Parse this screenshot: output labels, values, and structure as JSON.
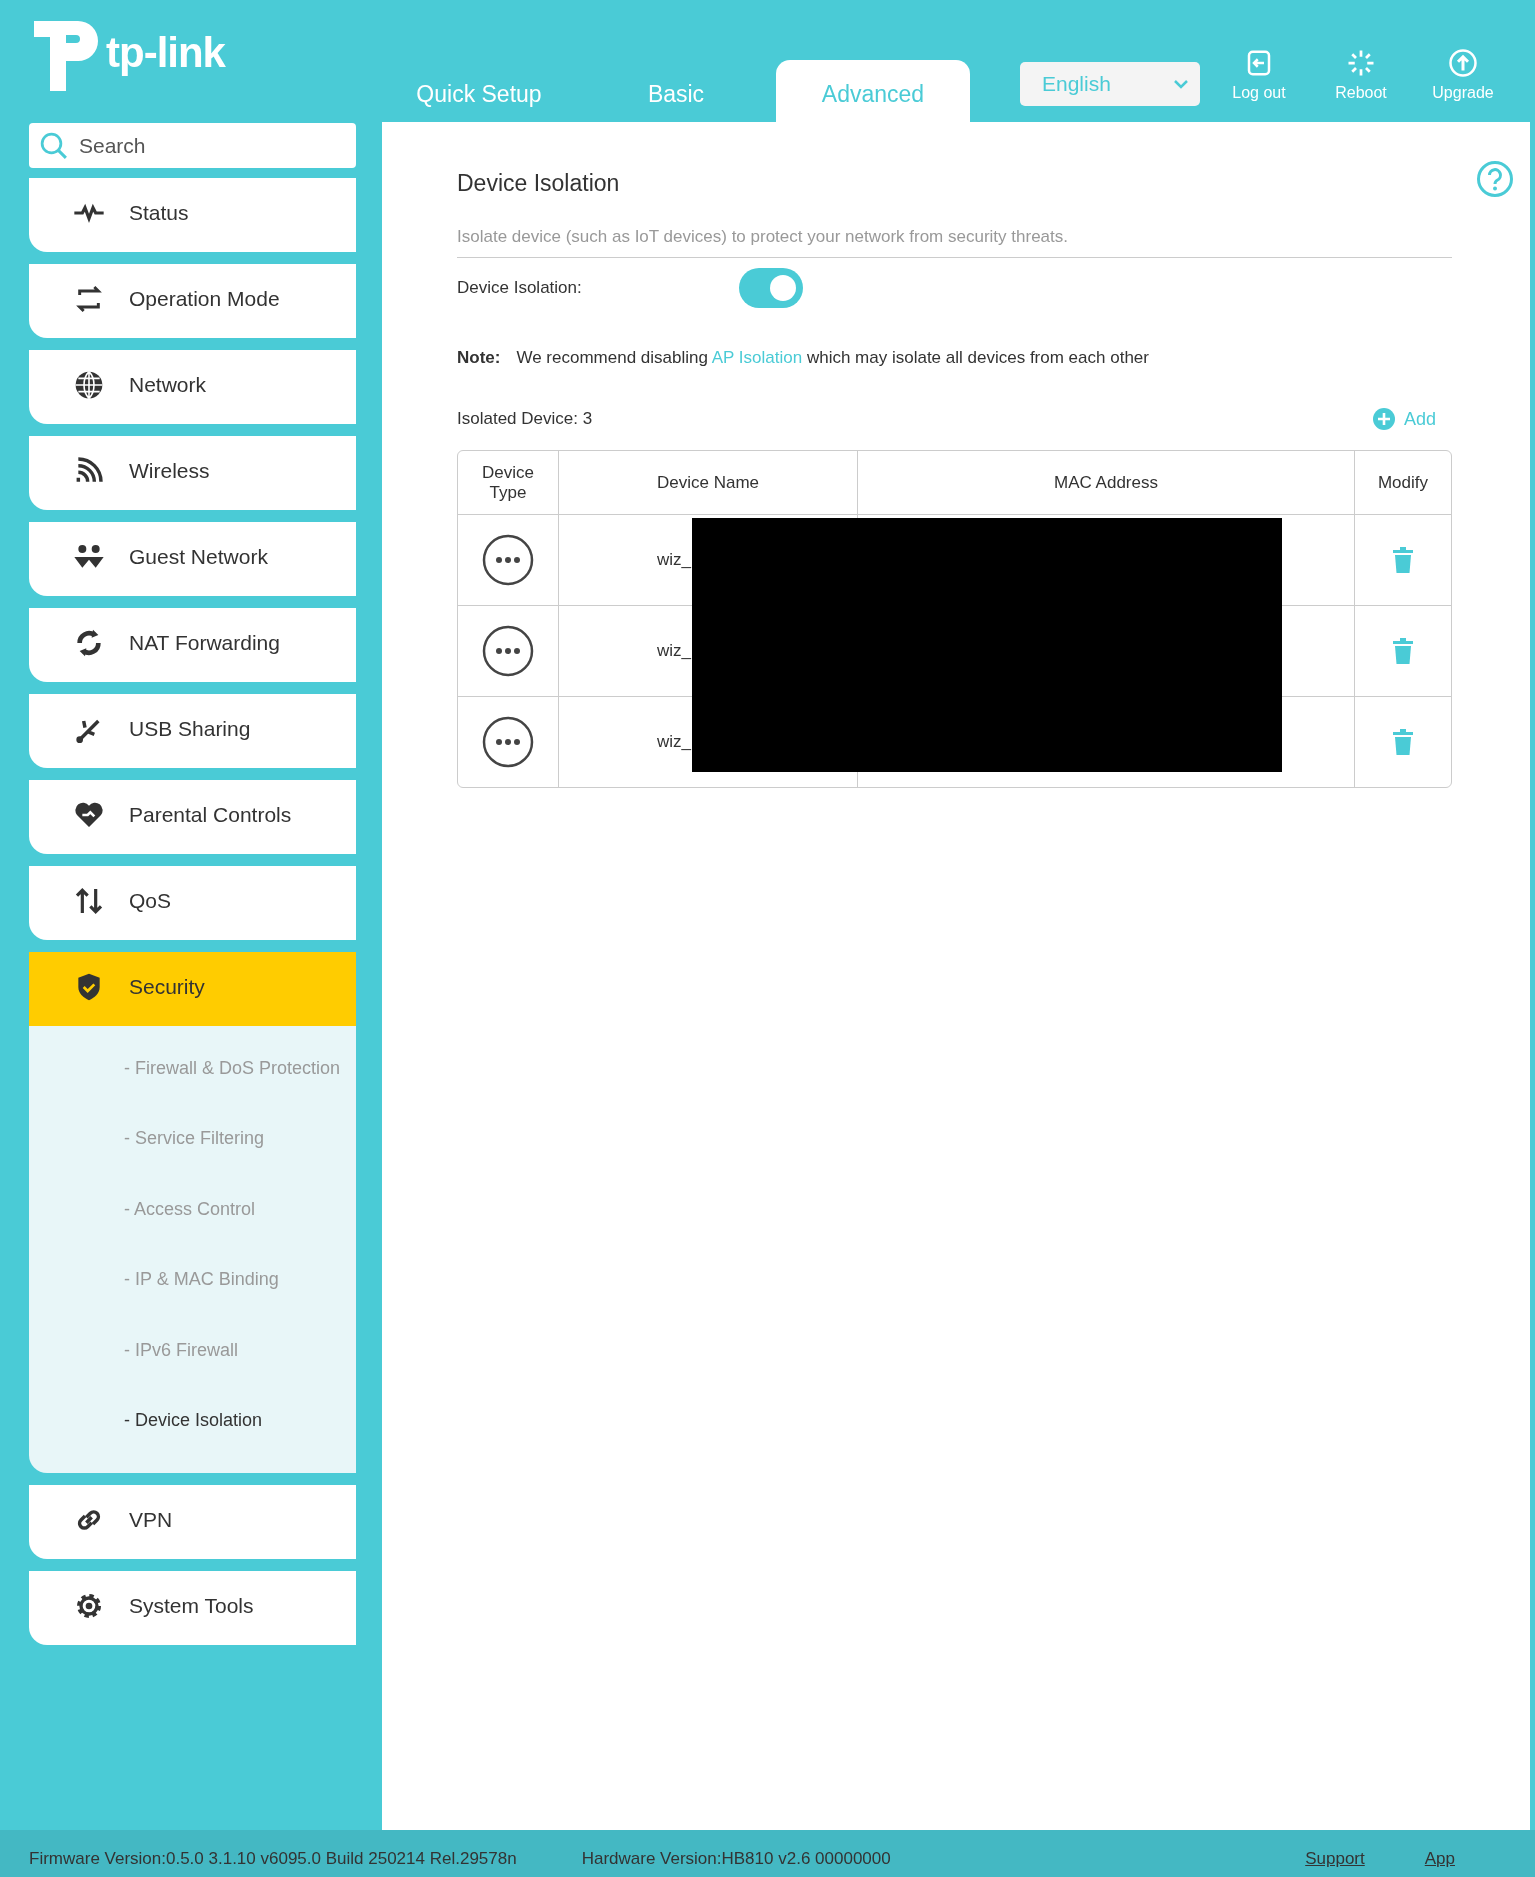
{
  "header": {
    "logo": "tp-link",
    "tabs": [
      {
        "label": "Quick Setup",
        "selected": false
      },
      {
        "label": "Basic",
        "selected": false
      },
      {
        "label": "Advanced",
        "selected": true
      }
    ],
    "language": "English",
    "actions": [
      {
        "kind": "logout",
        "label": "Log out"
      },
      {
        "kind": "reboot",
        "label": "Reboot"
      },
      {
        "kind": "upgrade",
        "label": "Upgrade"
      }
    ]
  },
  "sidebar": {
    "search": {
      "placeholder": "Search"
    },
    "items": [
      {
        "kind": "status",
        "label": "Status",
        "selected": false
      },
      {
        "kind": "mode",
        "label": "Operation Mode",
        "selected": false
      },
      {
        "kind": "globe",
        "label": "Network",
        "selected": false
      },
      {
        "kind": "wireless",
        "label": "Wireless",
        "selected": false
      },
      {
        "kind": "guest",
        "label": "Guest Network",
        "selected": false
      },
      {
        "kind": "nat",
        "label": "NAT Forwarding",
        "selected": false
      },
      {
        "kind": "usb",
        "label": "USB Sharing",
        "selected": false
      },
      {
        "kind": "heart",
        "label": "Parental Controls",
        "selected": false
      },
      {
        "kind": "qos",
        "label": "QoS",
        "selected": false
      },
      {
        "kind": "shield",
        "label": "Security",
        "selected": true,
        "children": [
          {
            "label": "- Firewall & DoS Protection",
            "selected": false
          },
          {
            "label": "- Service Filtering",
            "selected": false
          },
          {
            "label": "- Access Control",
            "selected": false
          },
          {
            "label": "- IP & MAC Binding",
            "selected": false
          },
          {
            "label": "- IPv6 Firewall",
            "selected": false
          },
          {
            "label": "- Device Isolation",
            "selected": true
          }
        ]
      },
      {
        "kind": "vpn",
        "label": "VPN",
        "selected": false
      },
      {
        "kind": "gear",
        "label": "System Tools",
        "selected": false
      }
    ]
  },
  "content": {
    "title": "Device Isolation",
    "description": "Isolate device (such as IoT devices) to protect your network from security threats.",
    "isolation": {
      "label": "Device Isolation:",
      "on": true
    },
    "note": {
      "label": "Note:",
      "before": "We recommend disabling",
      "link": "AP Isolation",
      "after": "which may isolate all devices from each other"
    },
    "count": "Isolated Device: 3",
    "add": "Add",
    "table": {
      "columns": [
        "Device Type",
        "Device Name",
        "MAC Address",
        "Modify"
      ],
      "redacted": true,
      "rows": [
        {
          "name": "wiz_"
        },
        {
          "name": "wiz_"
        },
        {
          "name": "wiz_"
        }
      ]
    }
  },
  "footer": {
    "firmware": "Firmware Version:0.5.0 3.1.10 v6095.0 Build 250214 Rel.29578n",
    "hardware": "Hardware Version:HB810 v2.6 00000000",
    "links": [
      "Support",
      "App"
    ]
  }
}
